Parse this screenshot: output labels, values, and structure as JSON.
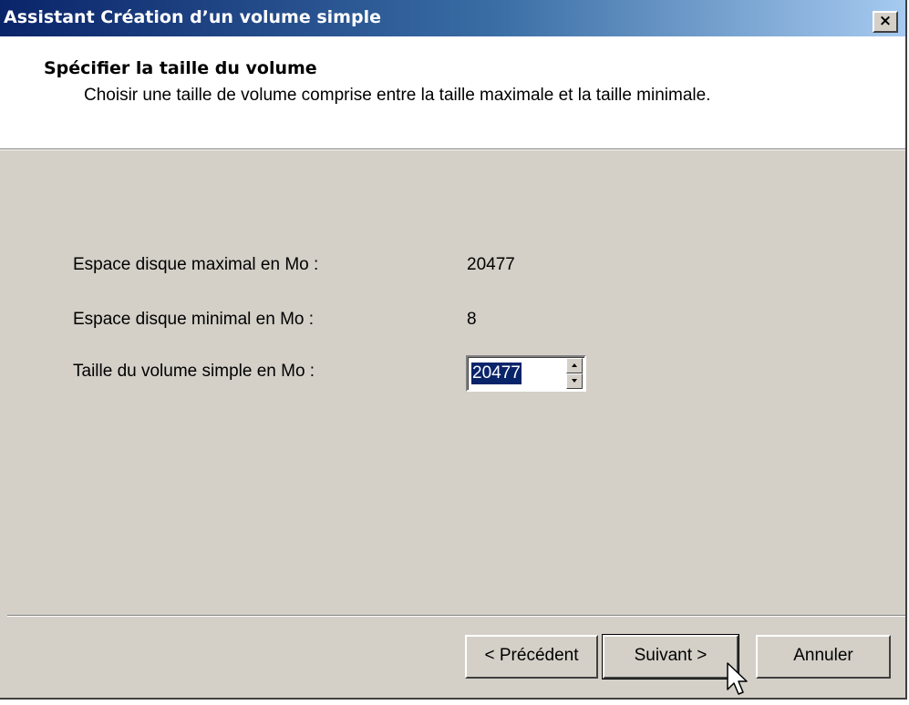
{
  "window": {
    "title": "Assistant Création d’un volume simple",
    "close_label": "×"
  },
  "header": {
    "title": "Spécifier la taille du volume",
    "subtitle": "Choisir une taille de volume comprise entre la taille maximale et la taille minimale."
  },
  "form": {
    "max_label": "Espace disque maximal en Mo :",
    "max_value": "20477",
    "min_label": "Espace disque minimal en Mo :",
    "min_value": "8",
    "size_label": "Taille du volume simple en Mo :",
    "size_value": "20477"
  },
  "buttons": {
    "back_label": "< Précédent",
    "next_label": "Suivant >",
    "cancel_label": "Annuler"
  },
  "icons": {
    "close": "close-icon",
    "spin_up": "arrow-up-icon",
    "spin_down": "arrow-down-icon",
    "cursor": "mouse-pointer-icon"
  },
  "colors": {
    "titlebar_start": "#0a246a",
    "titlebar_end": "#a6caf0",
    "dialog_bg": "#d4d0c8",
    "selection": "#0a246a"
  }
}
